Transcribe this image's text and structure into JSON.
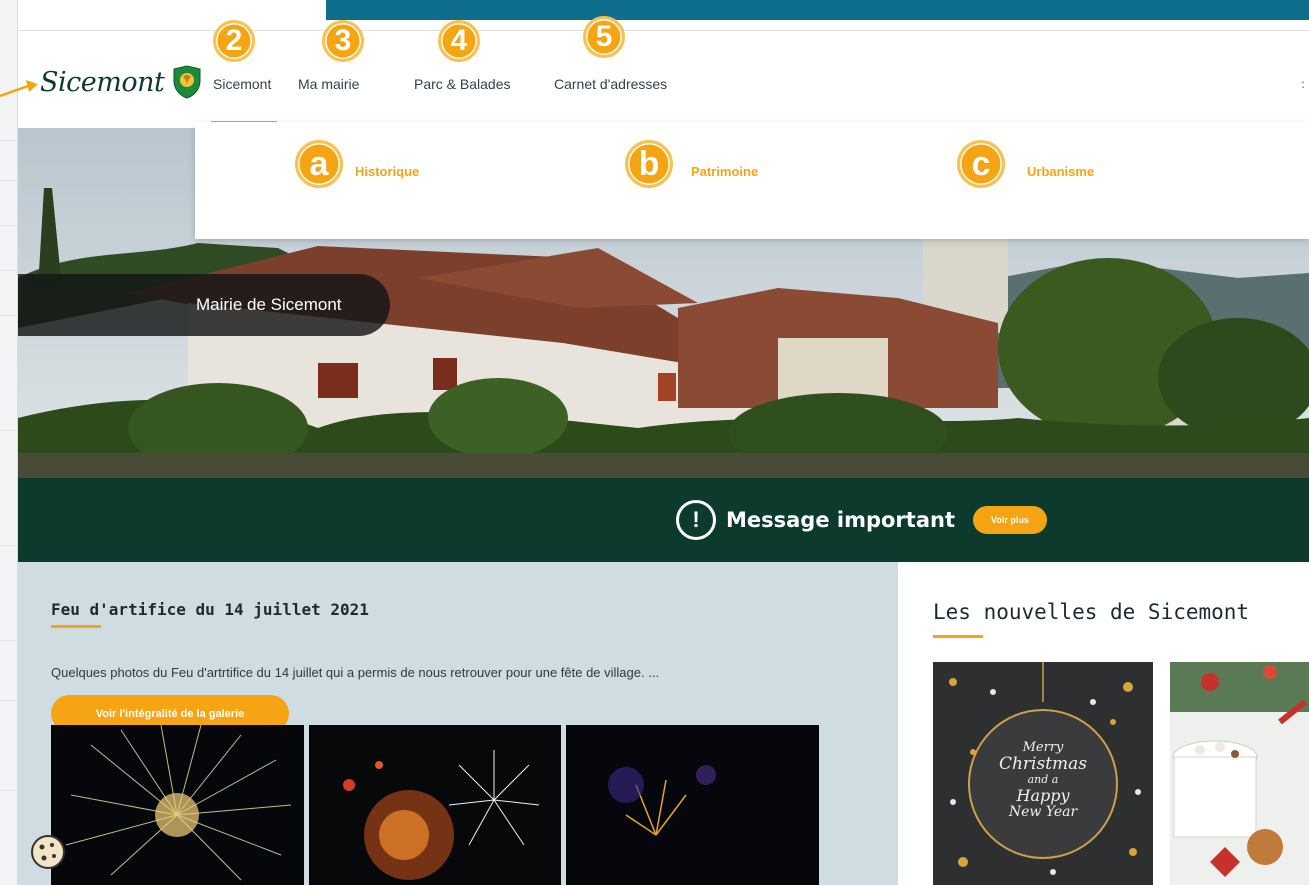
{
  "header": {
    "logo_text": "Sicemont",
    "nav": [
      {
        "label": "Sicemont",
        "badge": "2"
      },
      {
        "label": "Ma mairie",
        "badge": "3"
      },
      {
        "label": "Parc & Balades",
        "badge": "4"
      },
      {
        "label": "Carnet d'adresses",
        "badge": "5"
      }
    ],
    "right_glyph": ":"
  },
  "dropdown": {
    "items": [
      {
        "label": "Historique",
        "badge": "a"
      },
      {
        "label": "Patrimoine",
        "badge": "b"
      },
      {
        "label": "Urbanisme",
        "badge": "c"
      }
    ]
  },
  "hero": {
    "caption": "Mairie de Sicemont"
  },
  "banner": {
    "icon_glyph": "!",
    "text": "Message important",
    "button_label": "Voir plus"
  },
  "gallery_card": {
    "title": "Feu d'artifice du 14 juillet 2021",
    "description": "Quelques photos du Feu d'artrtifice du 14 juillet qui a permis de nous retrouver pour une fête de village. ...",
    "button_label": "Voir l'intégralité de la galerie"
  },
  "news": {
    "title": "Les nouvelles de Sicemont",
    "christmas_card_text": [
      "Merry",
      "Christmas",
      "and a",
      "Happy",
      "New Year"
    ]
  },
  "colors": {
    "accent": "#f5a414",
    "banner_bg": "#0c3b2e",
    "top_strip": "#0e6e8c",
    "card_bg": "#cfdde2"
  }
}
